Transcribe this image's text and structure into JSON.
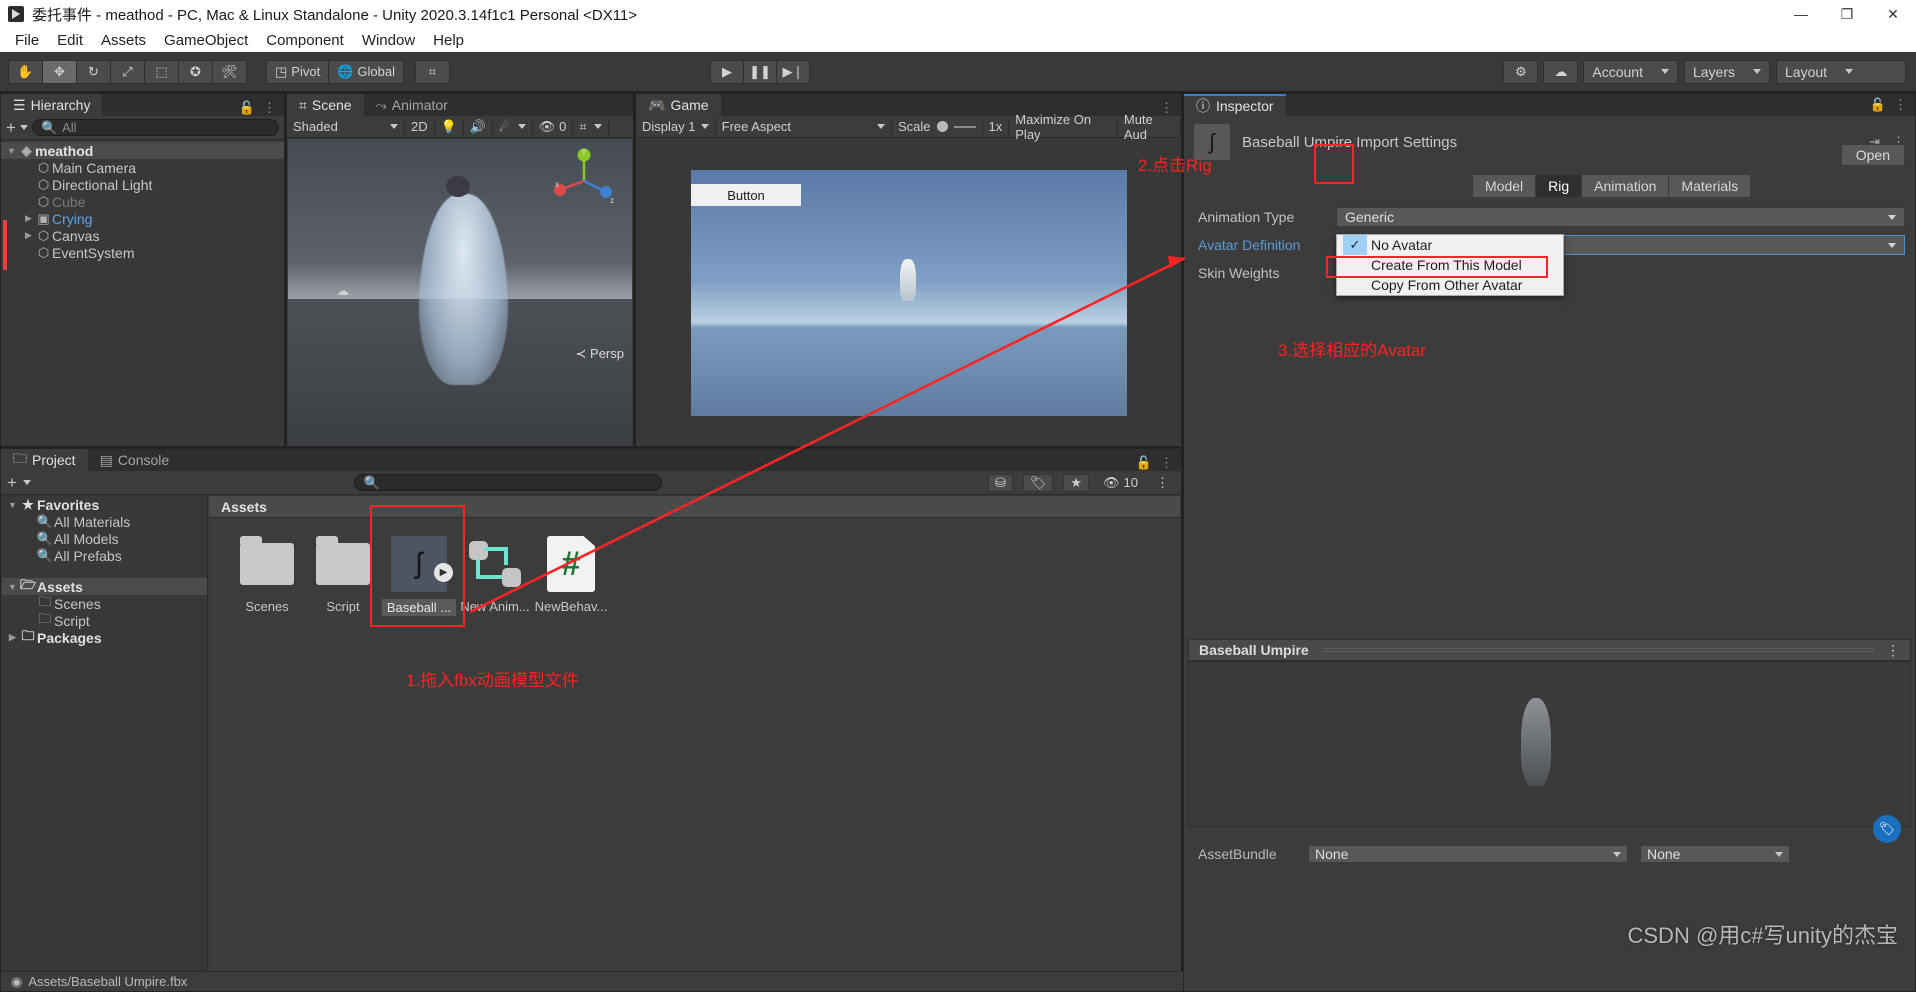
{
  "window": {
    "title": "委托事件 - meathod - PC, Mac & Linux Standalone - Unity 2020.3.14f1c1 Personal <DX11>",
    "minimize": "—",
    "maximize": "❐",
    "close": "✕"
  },
  "menubar": {
    "items": [
      "File",
      "Edit",
      "Assets",
      "GameObject",
      "Component",
      "Window",
      "Help"
    ]
  },
  "toolbar": {
    "tools": [
      "hand-tool",
      "move-tool",
      "rotate-tool",
      "scale-tool",
      "rect-tool",
      "transform-tool",
      "custom-tool"
    ],
    "pivot_label": "Pivot",
    "global_label": "Global",
    "snap_label": "grid-snap",
    "play": "▶",
    "pause": "❚❚",
    "step": "▶❘",
    "collab_label": "collab-icon",
    "cloud_label": "cloud-icon",
    "account_label": "Account",
    "layers_label": "Layers",
    "layout_label": "Layout"
  },
  "hierarchy": {
    "tab": "Hierarchy",
    "add_label": "+",
    "search_placeholder": "All",
    "items": [
      {
        "label": "meathod",
        "indent": 0,
        "twirl": "▼",
        "icon": "unity-scene-icon",
        "style": "bold",
        "selected": true
      },
      {
        "label": "Main Camera",
        "indent": 1,
        "twirl": "",
        "icon": "cube-icon",
        "style": ""
      },
      {
        "label": "Directional Light",
        "indent": 1,
        "twirl": "",
        "icon": "cube-icon",
        "style": ""
      },
      {
        "label": "Cube",
        "indent": 1,
        "twirl": "",
        "icon": "cube-icon",
        "style": "dim"
      },
      {
        "label": "Crying",
        "indent": 1,
        "twirl": "▶",
        "icon": "prefab-icon",
        "style": "blue"
      },
      {
        "label": "Canvas",
        "indent": 1,
        "twirl": "▶",
        "icon": "cube-icon",
        "style": ""
      },
      {
        "label": "EventSystem",
        "indent": 1,
        "twirl": "",
        "icon": "cube-icon",
        "style": ""
      }
    ]
  },
  "scene": {
    "tabs": [
      "Scene",
      "Animator"
    ],
    "active_tab": "Scene",
    "shading_mode": "Shaded",
    "mode_2d": "2D",
    "lighting_icon": "lightbulb-icon",
    "audio_icon": "speaker-icon",
    "fx_icon": "effects-icon",
    "hidden_count": "0",
    "grid_icon": "grid-icon",
    "persp_label": "Persp",
    "gizmo_axes": [
      "x",
      "y",
      "z"
    ]
  },
  "game": {
    "tab": "Game",
    "display": "Display 1",
    "aspect": "Free Aspect",
    "scale_label": "Scale",
    "scale_value": "1x",
    "maximize_on_play": "Maximize On Play",
    "mute_audio": "Mute Aud",
    "ui_button_label": "Button"
  },
  "inspector": {
    "tab": "Inspector",
    "title": "Baseball Umpire Import Settings",
    "open_label": "Open",
    "tabs": [
      "Model",
      "Rig",
      "Animation",
      "Materials"
    ],
    "active_tab": "Rig",
    "rows": [
      {
        "label": "Animation Type",
        "value": "Generic",
        "blue": false,
        "focus": false
      },
      {
        "label": "Avatar Definition",
        "value": "No Avatar",
        "blue": true,
        "focus": true
      },
      {
        "label": "Skin Weights",
        "value": "",
        "blue": false,
        "focus": false
      }
    ],
    "dropdown_options": [
      {
        "label": "No Avatar",
        "checked": true
      },
      {
        "label": "Create From This Model",
        "checked": false
      },
      {
        "label": "Copy From Other Avatar",
        "checked": false
      }
    ],
    "preview_title": "Baseball Umpire",
    "assetbundle_label": "AssetBundle",
    "assetbundle_value": "None",
    "assetbundle_variant": "None"
  },
  "project": {
    "tabs": [
      "Project",
      "Console"
    ],
    "active_tab": "Project",
    "add_label": "+",
    "search_placeholder": "",
    "star_count": "10",
    "tree": [
      {
        "label": "Favorites",
        "indent": 0,
        "twirl": "▼",
        "icon": "star-icon",
        "style": "bold"
      },
      {
        "label": "All Materials",
        "indent": 1,
        "twirl": "",
        "icon": "search-icon",
        "style": ""
      },
      {
        "label": "All Models",
        "indent": 1,
        "twirl": "",
        "icon": "search-icon",
        "style": ""
      },
      {
        "label": "All Prefabs",
        "indent": 1,
        "twirl": "",
        "icon": "search-icon",
        "style": ""
      },
      {
        "label": "",
        "indent": 0,
        "twirl": "",
        "icon": "",
        "style": "spacer"
      },
      {
        "label": "Assets",
        "indent": 0,
        "twirl": "▼",
        "icon": "folder-open-icon",
        "style": "bold",
        "selected": true
      },
      {
        "label": "Scenes",
        "indent": 1,
        "twirl": "",
        "icon": "folder-icon",
        "style": ""
      },
      {
        "label": "Script",
        "indent": 1,
        "twirl": "",
        "icon": "folder-icon",
        "style": ""
      },
      {
        "label": "Packages",
        "indent": 0,
        "twirl": "▶",
        "icon": "folder-icon",
        "style": "bold"
      }
    ],
    "breadcrumb": "Assets",
    "assets": [
      {
        "label": "Scenes",
        "type": "folder",
        "selected": false
      },
      {
        "label": "Script",
        "type": "folder",
        "selected": false
      },
      {
        "label": "Baseball ...",
        "type": "fbx",
        "selected": true
      },
      {
        "label": "New Anim...",
        "type": "animator",
        "selected": false
      },
      {
        "label": "NewBehav...",
        "type": "csharp",
        "selected": false
      }
    ],
    "status_path": "Assets/Baseball Umpire.fbx"
  },
  "annotations": {
    "step1": "1.拖入fbx动画模型文件",
    "step2": "2.点击Rig",
    "step3": "3.选择相应的Avatar"
  },
  "watermark": "CSDN @用c#写unity的杰宝"
}
